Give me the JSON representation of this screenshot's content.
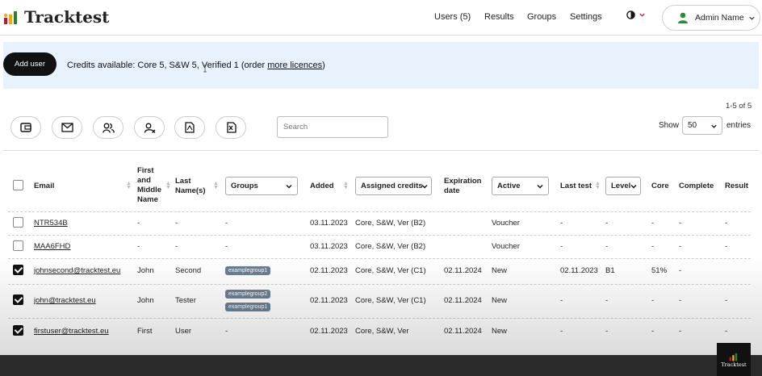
{
  "header": {
    "logo_text": "Tracktest",
    "nav": [
      {
        "label": "Users (5)"
      },
      {
        "label": "Results"
      },
      {
        "label": "Groups"
      },
      {
        "label": "Settings"
      }
    ],
    "admin_name": "Admin Name"
  },
  "banner": {
    "add_user_label": "Add user",
    "credits_prefix": "Credits available: Core 5, S&W 5, Verified 1 (order ",
    "credits_link": "more licences",
    "credits_suffix": ")"
  },
  "toolbar": {
    "range_text": "1-5 of 5",
    "search_placeholder": "Search",
    "show_label": "Show",
    "entries_value": "50",
    "entries_label": "entries"
  },
  "table": {
    "headers": {
      "email": "Email",
      "first_1": "First",
      "first_2": "and",
      "first_3": "Middle",
      "first_4": "Name",
      "last_1": "Last",
      "last_2": "Name(s)",
      "groups": "Groups",
      "added": "Added",
      "assigned": "Assigned credits",
      "exp_1": "Expiration",
      "exp_2": "date",
      "active": "Active",
      "last_test": "Last test",
      "level": "Level",
      "core": "Core",
      "complete": "Complete",
      "result": "Result"
    },
    "rows": [
      {
        "checked": false,
        "email": "NTR534B",
        "first": "-",
        "last": "-",
        "groups": "-",
        "added": "03.11.2023",
        "credits": "Core, S&W, Ver (B2)",
        "expiration": "",
        "active": "Voucher",
        "last_test": "-",
        "level": "-",
        "core": "-",
        "complete": "-",
        "result": "-"
      },
      {
        "checked": false,
        "email": "MAA6FHD",
        "first": "-",
        "last": "-",
        "groups": "-",
        "added": "03.11.2023",
        "credits": "Core, S&W, Ver (B2)",
        "expiration": "",
        "active": "Voucher",
        "last_test": "-",
        "level": "-",
        "core": "-",
        "complete": "-",
        "result": "-"
      },
      {
        "checked": true,
        "email": "johnsecond@tracktest.eu",
        "first": "John",
        "last": "Second",
        "groups": "",
        "group_tags": [
          "examplegroup1"
        ],
        "added": "02.11.2023",
        "credits": "Core, S&W, Ver (C1)",
        "expiration": "02.11.2024",
        "active": "New",
        "last_test": "02.11.2023",
        "level": "B1",
        "core": "51%",
        "complete": "-",
        "result": ""
      },
      {
        "checked": true,
        "email": "john@tracktest.eu",
        "first": "John",
        "last": "Tester",
        "groups": "",
        "group_tags": [
          "examplegroup2",
          "examplegroup1"
        ],
        "added": "02.11.2023",
        "credits": "Core, S&W, Ver (C1)",
        "expiration": "02.11.2024",
        "active": "New",
        "last_test": "-",
        "level": "-",
        "core": "-",
        "complete": "-",
        "result": "-"
      },
      {
        "checked": true,
        "email": "firstuser@tracktest.eu",
        "first": "First",
        "last": "User",
        "groups": "-",
        "added": "02.11.2023",
        "credits": "Core, S&W, Ver",
        "expiration": "02.11.2024",
        "active": "New",
        "last_test": "-",
        "level": "-",
        "core": "-",
        "complete": "-",
        "result": "-"
      }
    ]
  },
  "badge_text": "Tracktest",
  "colors": {
    "banner": "#e8f2fc",
    "tag": "#6b7f94",
    "button": "#111111"
  }
}
